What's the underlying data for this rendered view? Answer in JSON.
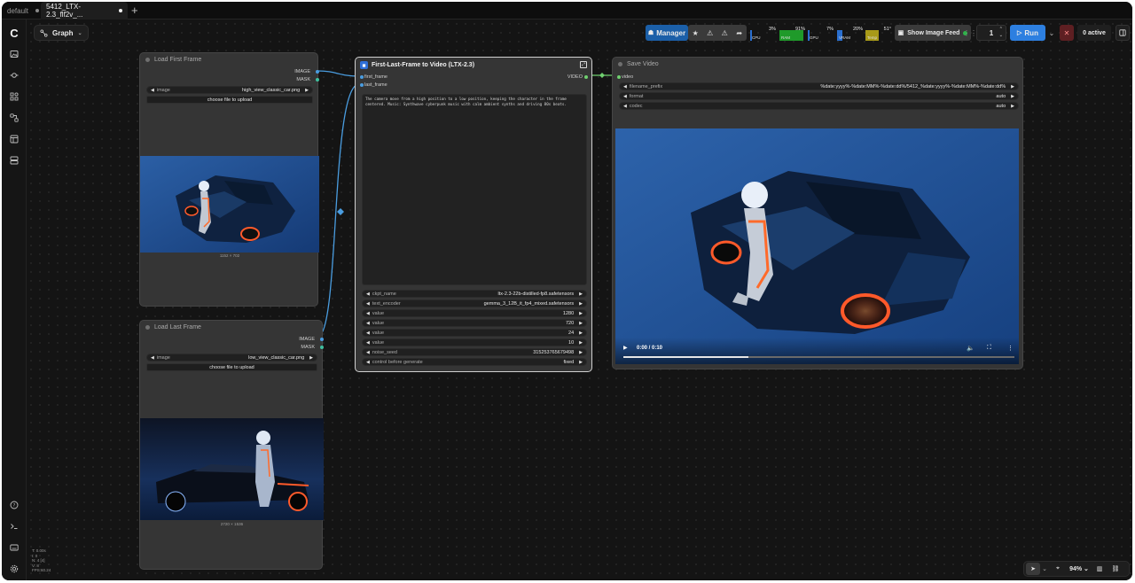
{
  "tabs": [
    {
      "label": "default"
    },
    {
      "label": "5412_LTX-2.3_flf2v_..."
    }
  ],
  "graph_button": {
    "label": "Graph"
  },
  "toolbar": {
    "manager_label": "Manager",
    "resources": [
      {
        "label": "CPU",
        "percent": "3%",
        "color": "#2a6fd0",
        "fill": 0.03
      },
      {
        "label": "RAM",
        "percent": "91%",
        "color": "#1f9a2a",
        "fill": 0.91
      },
      {
        "label": "GPU",
        "percent": "7%",
        "color": "#2a6fd0",
        "fill": 0.07
      },
      {
        "label": "VRAM",
        "percent": "20%",
        "color": "#2a6fd0",
        "fill": 0.2
      },
      {
        "label": "Temp",
        "percent": "51°",
        "color": "#a89a18",
        "fill": 0.51
      }
    ],
    "image_feed_label": "Show Image Feed",
    "batch_count": "1",
    "run_label": "Run",
    "active_label": "0 active"
  },
  "nodes": {
    "load_first": {
      "title": "Load First Frame",
      "outputs": [
        "IMAGE",
        "MASK"
      ],
      "image_label": "image",
      "image_value": "high_view_classic_car.png",
      "upload_label": "choose file to upload",
      "dims": "1152 × 702"
    },
    "load_last": {
      "title": "Load Last Frame",
      "outputs": [
        "IMAGE",
        "MASK"
      ],
      "image_label": "image",
      "image_value": "low_view_classic_car.png",
      "upload_label": "choose file to upload",
      "dims": "2720 × 1536"
    },
    "flf": {
      "title": "First-Last-Frame to Video (LTX-2.3)",
      "inputs": [
        "first_frame",
        "last_frame"
      ],
      "output": "VIDEO",
      "prompt": "The camera move from a high position to a low position, keeping the character in the frame centered. Music: Synthwave cyberpunk music with calm ambient synths and driving 80s beats.",
      "widgets": [
        {
          "label": "ckpt_name",
          "value": "ltx-2.3-22b-distilled-fp8.safetensors"
        },
        {
          "label": "text_encoder",
          "value": "gemma_3_12B_it_fp4_mixed.safetensors"
        },
        {
          "label": "value",
          "value": "1280"
        },
        {
          "label": "value",
          "value": "720"
        },
        {
          "label": "value",
          "value": "24"
        },
        {
          "label": "value",
          "value": "10"
        },
        {
          "label": "noise_seed",
          "value": "315253765679498"
        },
        {
          "label": "control before generate",
          "value": "fixed"
        }
      ]
    },
    "save_video": {
      "title": "Save Video",
      "input": "video",
      "widgets": [
        {
          "label": "filename_prefix",
          "value": "%date:yyyy%-%date:MM%-%date:dd%/5412_%date:yyyy%-%date:MM%-%date:dd%"
        },
        {
          "label": "format",
          "value": "auto"
        },
        {
          "label": "codec",
          "value": "auto"
        }
      ],
      "time": "0:00 / 0:10",
      "progress": 0.32
    }
  },
  "stats": [
    "T: 0.00s",
    "I: 0",
    "N: 4 [4]",
    "V: 8",
    "FPS:60.24"
  ],
  "bottom_bar": {
    "zoom": "94%"
  }
}
